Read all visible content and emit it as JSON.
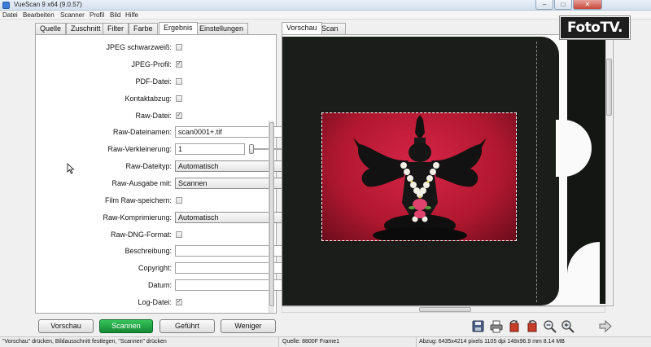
{
  "window": {
    "title": "VueScan 9 x64 (9.0.57)",
    "controls": {
      "minimize": "–",
      "maximize": "□",
      "close": "✕"
    }
  },
  "menu": [
    "Datei",
    "Bearbeiten",
    "Scanner",
    "Profil",
    "Bild",
    "Hilfe"
  ],
  "left_tabs": [
    "Quelle",
    "Zuschnitt",
    "Filter",
    "Farbe",
    "Ergebnis",
    "Einstellungen"
  ],
  "active_left_tab": "Ergebnis",
  "settings": {
    "jpeg_bw": {
      "label": "JPEG schwarzweiß:",
      "checked": false,
      "mark": ""
    },
    "jpeg_profile": {
      "label": "JPEG-Profil:",
      "checked": true,
      "mark": "✓"
    },
    "pdf_file": {
      "label": "PDF-Datei:",
      "checked": false,
      "mark": ""
    },
    "contact_sheet": {
      "label": "Kontaktabzug:",
      "checked": false,
      "mark": ""
    },
    "raw_file": {
      "label": "Raw-Datei:",
      "checked": true,
      "mark": "✓"
    },
    "raw_filename": {
      "label": "Raw-Dateinamen:",
      "value": "scan0001+.tif"
    },
    "raw_reduction": {
      "label": "Raw-Verkleinerung:",
      "value": "1"
    },
    "raw_filetype": {
      "label": "Raw-Dateityp:",
      "value": "Automatisch"
    },
    "raw_output_with": {
      "label": "Raw-Ausgabe mit:",
      "value": "Scannen"
    },
    "film_raw_save": {
      "label": "Film Raw-speichern:",
      "checked": false,
      "mark": ""
    },
    "raw_compression": {
      "label": "Raw-Komprimierung:",
      "value": "Automatisch"
    },
    "raw_dng": {
      "label": "Raw-DNG-Format:",
      "checked": false,
      "mark": ""
    },
    "description": {
      "label": "Beschreibung:",
      "value": ""
    },
    "copyright": {
      "label": "Copyright:",
      "value": ""
    },
    "date": {
      "label": "Datum:",
      "value": ""
    },
    "log_file": {
      "label": "Log-Datei:",
      "checked": true,
      "mark": "✓"
    }
  },
  "right_tabs": [
    "Vorschau",
    "Scan"
  ],
  "active_right_tab": "Vorschau",
  "bottom_buttons": {
    "preview": "Vorschau",
    "scan": "Scannen",
    "guided": "Geführt",
    "less": "Weniger"
  },
  "toolbar_icons": [
    "save-icon",
    "print-icon",
    "rotate-left-icon",
    "rotate-right-icon",
    "zoom-out-icon",
    "zoom-in-icon",
    "arrow-right-icon"
  ],
  "status": {
    "hint": "\"Vorschau\" drücken, Bildausschnitt festlegen, \"Scannen\" drücken",
    "source": "Quelle: 8800F Frame1",
    "output": "Abzug: 6435x4214 pixels 1105 dpi 148x96.9 mm 8.14 MB"
  },
  "watermark": "FotoTV.",
  "colors": {
    "scan_button": "#1f9d3f",
    "photo_background": "#c01a36",
    "film_base": "#1b1d1a"
  }
}
